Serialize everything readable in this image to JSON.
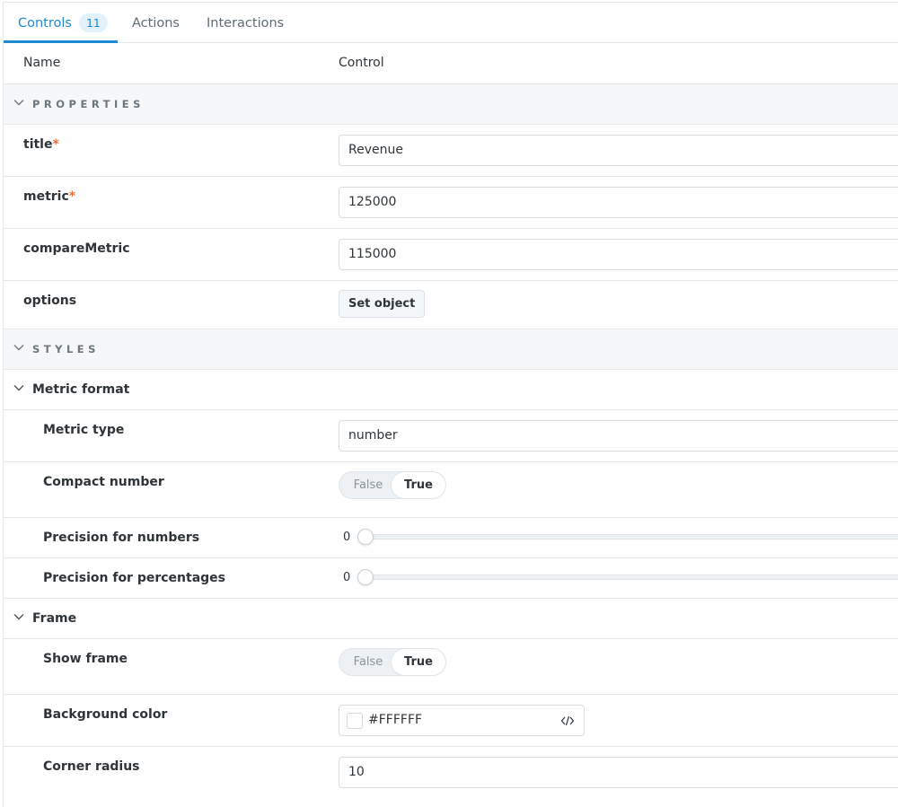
{
  "tabs": [
    {
      "label": "Controls",
      "badge": "11"
    },
    {
      "label": "Actions"
    },
    {
      "label": "Interactions"
    }
  ],
  "columns": {
    "name": "Name",
    "control": "Control"
  },
  "sections": {
    "properties": "PROPERTIES",
    "styles": "STYLES"
  },
  "subsections": {
    "metric_format": "Metric format",
    "frame": "Frame"
  },
  "rows": {
    "title": {
      "name": "title",
      "required": "*",
      "value": "Revenue"
    },
    "metric": {
      "name": "metric",
      "required": "*",
      "value": "125000"
    },
    "compare_metric": {
      "name": "compareMetric",
      "value": "115000"
    },
    "options": {
      "name": "options",
      "button": "Set object"
    },
    "metric_type": {
      "name": "Metric type",
      "value": "number"
    },
    "compact_number": {
      "name": "Compact number",
      "false_label": "False",
      "true_label": "True",
      "selected": "True"
    },
    "precision_numbers": {
      "name": "Precision for numbers",
      "value": "0"
    },
    "precision_percentages": {
      "name": "Precision for percentages",
      "value": "0"
    },
    "show_frame": {
      "name": "Show frame",
      "false_label": "False",
      "true_label": "True",
      "selected": "True"
    },
    "background_color": {
      "name": "Background color",
      "value": "#FFFFFF"
    },
    "corner_radius": {
      "name": "Corner radius",
      "value": "10"
    }
  },
  "colors": {
    "accent": "#1e8ad2",
    "required": "#f06b3e",
    "section_bg": "#f5f7f9"
  },
  "icons": [
    "chevron-down-icon",
    "code-icon"
  ]
}
